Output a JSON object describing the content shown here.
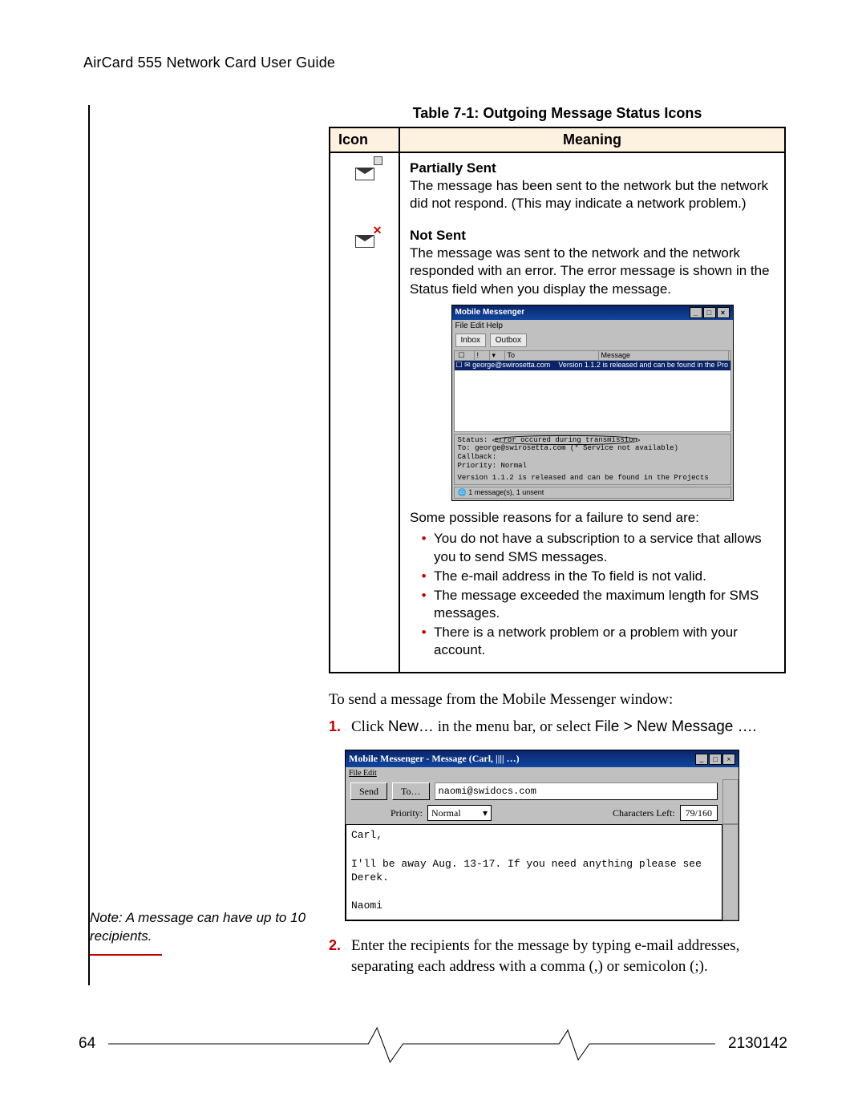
{
  "header": {
    "title": "AirCard 555 Network Card User Guide"
  },
  "table": {
    "caption": "Table 7-1: Outgoing Message Status Icons",
    "col_icon": "Icon",
    "col_meaning": "Meaning",
    "row1": {
      "heading": "Partially Sent",
      "body": "The message has been sent to the network but the network did not respond. (This may indicate a network problem.)"
    },
    "row2": {
      "heading": "Not Sent",
      "body": "The message was sent to the network and the network responded with an error. The error message is shown in the Status field when you display the message.",
      "app": {
        "title": "Mobile Messenger",
        "menu": "File  Edit  Help",
        "tab_inbox": "Inbox",
        "tab_outbox": "Outbox",
        "col_to": "To",
        "col_msg": "Message",
        "row_to": "george@swirosetta.com",
        "row_msg": "Version 1.1.2 is released and can be found in the Pro",
        "status_label": "Status:",
        "status_value": "error occured during transmission",
        "to_label": "To:",
        "to_value": "george@swirosetta.com (* Service not available)",
        "callback_label": "Callback:",
        "callback_value": "",
        "priority_label": "Priority:",
        "priority_value": "Normal",
        "body_line": "Version 1.1.2 is released and can be found in the Projects",
        "footer": "1 message(s), 1 unsent"
      },
      "reasons_intro": "Some possible reasons for a failure to send are:",
      "reasons": [
        "You do not have a subscription to a service that allows you to send SMS messages.",
        "The e-mail address in the To field is not valid.",
        "The message exceeded the maximum length for SMS messages.",
        "There is a network problem or a problem with your account."
      ]
    }
  },
  "instructions": {
    "intro": "To send a message from the Mobile Messenger window:",
    "step1_prefix": "Click ",
    "step1_new": "New…",
    "step1_mid": " in the menu bar, or select ",
    "step1_path": "File > New Message …",
    "step1_suffix": ".",
    "step2": "Enter the recipients for the message by typing e-mail addresses, separating each address with a comma (,) or semicolon (;).",
    "num1": "1.",
    "num2": "2."
  },
  "compose": {
    "title": "Mobile Messenger - Message (Carl, ||||  …)",
    "menu": "File  Edit",
    "send": "Send",
    "to": "To…",
    "to_value": "naomi@swidocs.com",
    "priority_label": "Priority:",
    "priority_value": "Normal",
    "chars_label": "Characters Left:",
    "chars_value": "79/160",
    "body": "Carl,\n\nI'll be away Aug. 13-17. If you need anything please see Derek.\n\nNaomi"
  },
  "margin_note": "Note:  A message can have up to 10 recipients.",
  "footer": {
    "page": "64",
    "docnum": "2130142"
  }
}
